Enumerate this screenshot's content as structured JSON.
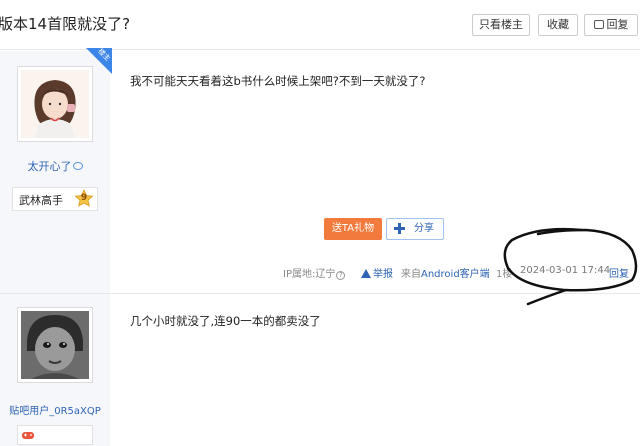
{
  "header": {
    "title": "版本14首限就没了?",
    "only_op_label": "只看楼主",
    "favorite_label": "收藏",
    "reply_label": "回复"
  },
  "post1": {
    "op_badge": "楼主",
    "username": "太开心了",
    "level_title": "武林高手",
    "level": "9",
    "text": "我不可能天天看着这b书什么时候上架吧?不到一天就没了?",
    "gift_label": "送TA礼物",
    "share_label": "分享",
    "ip_label": "IP属地:辽宁",
    "report_label": "举报",
    "source_prefix": "来自",
    "source_link": "Android客户端",
    "floor": "1楼",
    "time": "2024-03-01 17:44",
    "reply_label": "回复"
  },
  "post2": {
    "username": "贴吧用户_0R5aXQP",
    "text": "几个小时就没了,连90一本的都卖没了"
  },
  "colors": {
    "link_blue": "#2d64b3",
    "gift_orange": "#f27a3c",
    "op_badge_blue": "#3c86e8"
  }
}
